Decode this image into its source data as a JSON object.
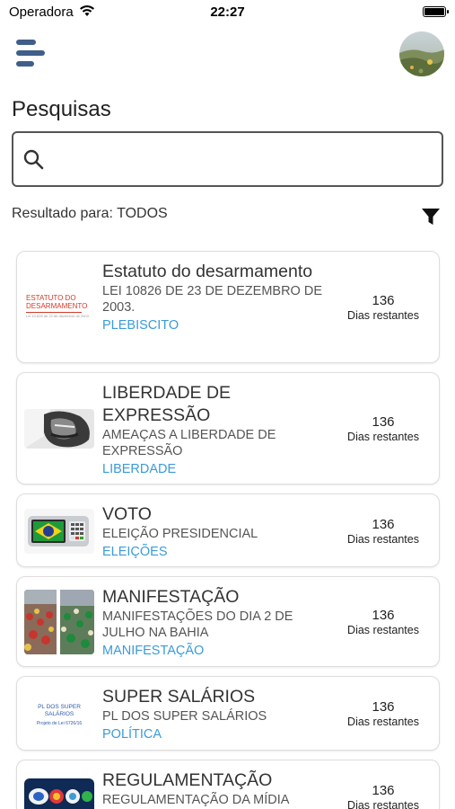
{
  "status": {
    "carrier": "Operadora",
    "time": "22:27"
  },
  "header": {
    "title": "Pesquisas"
  },
  "search": {
    "placeholder": "",
    "value": ""
  },
  "filter": {
    "result_text": "Resultado para: TODOS"
  },
  "theme": {
    "tag_color": "#3b9bd8",
    "menu_color": "#3f5f8a"
  },
  "cards": [
    {
      "title": "Estatuto do desarmamento",
      "subtitle": "LEI 10826 DE 23 DE DEZEMBRO DE 2003.",
      "tag": "PLEBISCITO",
      "count": "136",
      "count_label": "Dias restantes",
      "thumb_text": "ESTATUTO DO DESARMAMENTO",
      "thumb_subtext": "Lei 10.826 de 22 de dezembro de 2003"
    },
    {
      "title": "LIBERDADE DE EXPRESSÃO",
      "subtitle": "AMEAÇAS A LIBERDADE DE EXPRESSÃO",
      "tag": "LIBERDADE",
      "count": "136",
      "count_label": "Dias restantes"
    },
    {
      "title": "VOTO",
      "subtitle": "ELEIÇÃO PRESIDENCIAL",
      "tag": "ELEIÇÕES",
      "count": "136",
      "count_label": "Dias restantes"
    },
    {
      "title": "MANIFESTAÇÃO",
      "subtitle": "MANIFESTAÇÕES DO DIA 2 DE JULHO NA BAHIA",
      "tag": "MANIFESTAÇÃO",
      "count": "136",
      "count_label": "Dias restantes"
    },
    {
      "title": "SUPER SALÁRIOS",
      "subtitle": "PL DOS SUPER SALÁRIOS",
      "tag": "POLÍTICA",
      "count": "136",
      "count_label": "Dias restantes",
      "thumb_text": "PL DOS SUPER SALÁRIOS",
      "thumb_subtext": "Projeto de Lei 6726/16"
    },
    {
      "title": "REGULAMENTAÇÃO",
      "subtitle": "REGULAMENTAÇÃO DA MÍDIA",
      "tag": "",
      "count": "136",
      "count_label": "Dias restantes"
    }
  ]
}
